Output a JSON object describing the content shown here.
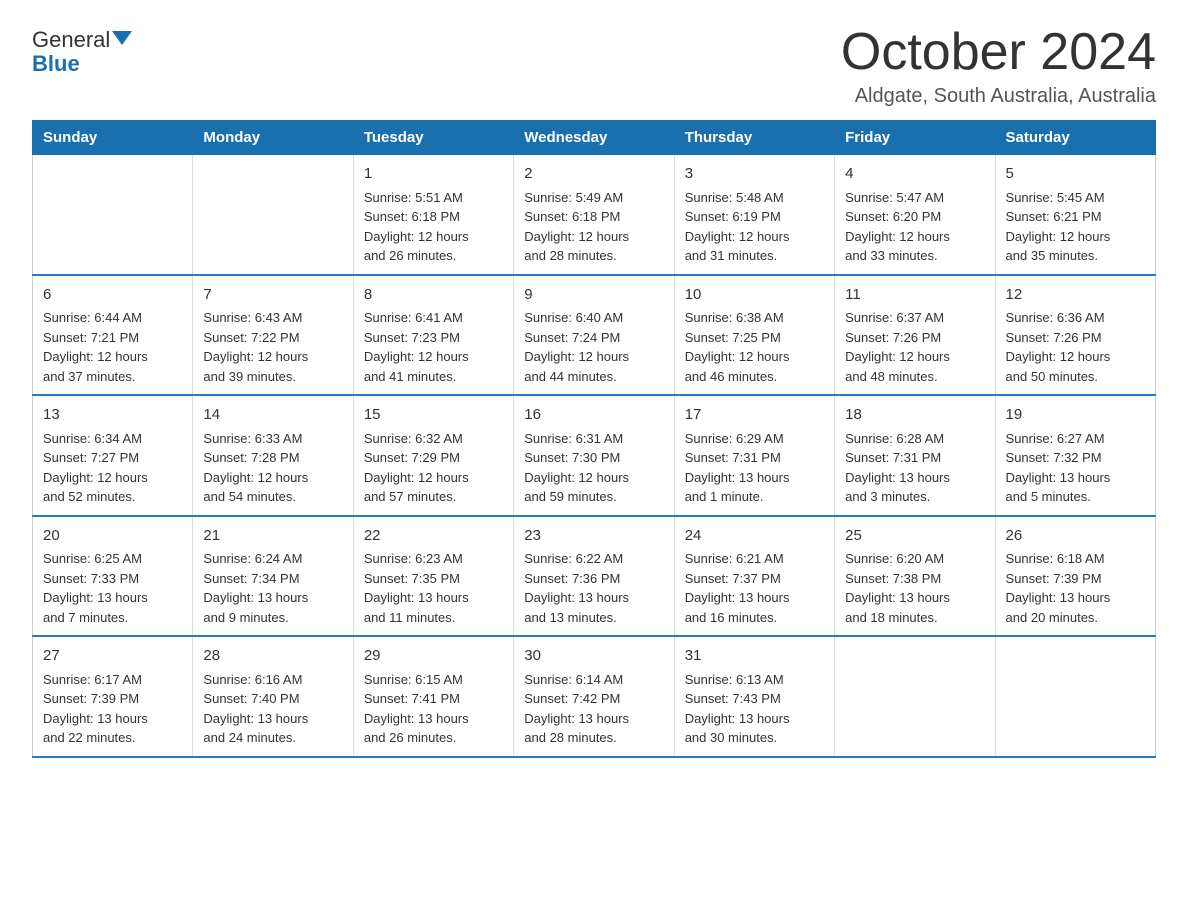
{
  "logo": {
    "general": "General",
    "blue": "Blue"
  },
  "header": {
    "month": "October 2024",
    "location": "Aldgate, South Australia, Australia"
  },
  "days": {
    "headers": [
      "Sunday",
      "Monday",
      "Tuesday",
      "Wednesday",
      "Thursday",
      "Friday",
      "Saturday"
    ]
  },
  "weeks": [
    [
      {
        "day": "",
        "detail": ""
      },
      {
        "day": "",
        "detail": ""
      },
      {
        "day": "1",
        "detail": "Sunrise: 5:51 AM\nSunset: 6:18 PM\nDaylight: 12 hours\nand 26 minutes."
      },
      {
        "day": "2",
        "detail": "Sunrise: 5:49 AM\nSunset: 6:18 PM\nDaylight: 12 hours\nand 28 minutes."
      },
      {
        "day": "3",
        "detail": "Sunrise: 5:48 AM\nSunset: 6:19 PM\nDaylight: 12 hours\nand 31 minutes."
      },
      {
        "day": "4",
        "detail": "Sunrise: 5:47 AM\nSunset: 6:20 PM\nDaylight: 12 hours\nand 33 minutes."
      },
      {
        "day": "5",
        "detail": "Sunrise: 5:45 AM\nSunset: 6:21 PM\nDaylight: 12 hours\nand 35 minutes."
      }
    ],
    [
      {
        "day": "6",
        "detail": "Sunrise: 6:44 AM\nSunset: 7:21 PM\nDaylight: 12 hours\nand 37 minutes."
      },
      {
        "day": "7",
        "detail": "Sunrise: 6:43 AM\nSunset: 7:22 PM\nDaylight: 12 hours\nand 39 minutes."
      },
      {
        "day": "8",
        "detail": "Sunrise: 6:41 AM\nSunset: 7:23 PM\nDaylight: 12 hours\nand 41 minutes."
      },
      {
        "day": "9",
        "detail": "Sunrise: 6:40 AM\nSunset: 7:24 PM\nDaylight: 12 hours\nand 44 minutes."
      },
      {
        "day": "10",
        "detail": "Sunrise: 6:38 AM\nSunset: 7:25 PM\nDaylight: 12 hours\nand 46 minutes."
      },
      {
        "day": "11",
        "detail": "Sunrise: 6:37 AM\nSunset: 7:26 PM\nDaylight: 12 hours\nand 48 minutes."
      },
      {
        "day": "12",
        "detail": "Sunrise: 6:36 AM\nSunset: 7:26 PM\nDaylight: 12 hours\nand 50 minutes."
      }
    ],
    [
      {
        "day": "13",
        "detail": "Sunrise: 6:34 AM\nSunset: 7:27 PM\nDaylight: 12 hours\nand 52 minutes."
      },
      {
        "day": "14",
        "detail": "Sunrise: 6:33 AM\nSunset: 7:28 PM\nDaylight: 12 hours\nand 54 minutes."
      },
      {
        "day": "15",
        "detail": "Sunrise: 6:32 AM\nSunset: 7:29 PM\nDaylight: 12 hours\nand 57 minutes."
      },
      {
        "day": "16",
        "detail": "Sunrise: 6:31 AM\nSunset: 7:30 PM\nDaylight: 12 hours\nand 59 minutes."
      },
      {
        "day": "17",
        "detail": "Sunrise: 6:29 AM\nSunset: 7:31 PM\nDaylight: 13 hours\nand 1 minute."
      },
      {
        "day": "18",
        "detail": "Sunrise: 6:28 AM\nSunset: 7:31 PM\nDaylight: 13 hours\nand 3 minutes."
      },
      {
        "day": "19",
        "detail": "Sunrise: 6:27 AM\nSunset: 7:32 PM\nDaylight: 13 hours\nand 5 minutes."
      }
    ],
    [
      {
        "day": "20",
        "detail": "Sunrise: 6:25 AM\nSunset: 7:33 PM\nDaylight: 13 hours\nand 7 minutes."
      },
      {
        "day": "21",
        "detail": "Sunrise: 6:24 AM\nSunset: 7:34 PM\nDaylight: 13 hours\nand 9 minutes."
      },
      {
        "day": "22",
        "detail": "Sunrise: 6:23 AM\nSunset: 7:35 PM\nDaylight: 13 hours\nand 11 minutes."
      },
      {
        "day": "23",
        "detail": "Sunrise: 6:22 AM\nSunset: 7:36 PM\nDaylight: 13 hours\nand 13 minutes."
      },
      {
        "day": "24",
        "detail": "Sunrise: 6:21 AM\nSunset: 7:37 PM\nDaylight: 13 hours\nand 16 minutes."
      },
      {
        "day": "25",
        "detail": "Sunrise: 6:20 AM\nSunset: 7:38 PM\nDaylight: 13 hours\nand 18 minutes."
      },
      {
        "day": "26",
        "detail": "Sunrise: 6:18 AM\nSunset: 7:39 PM\nDaylight: 13 hours\nand 20 minutes."
      }
    ],
    [
      {
        "day": "27",
        "detail": "Sunrise: 6:17 AM\nSunset: 7:39 PM\nDaylight: 13 hours\nand 22 minutes."
      },
      {
        "day": "28",
        "detail": "Sunrise: 6:16 AM\nSunset: 7:40 PM\nDaylight: 13 hours\nand 24 minutes."
      },
      {
        "day": "29",
        "detail": "Sunrise: 6:15 AM\nSunset: 7:41 PM\nDaylight: 13 hours\nand 26 minutes."
      },
      {
        "day": "30",
        "detail": "Sunrise: 6:14 AM\nSunset: 7:42 PM\nDaylight: 13 hours\nand 28 minutes."
      },
      {
        "day": "31",
        "detail": "Sunrise: 6:13 AM\nSunset: 7:43 PM\nDaylight: 13 hours\nand 30 minutes."
      },
      {
        "day": "",
        "detail": ""
      },
      {
        "day": "",
        "detail": ""
      }
    ]
  ]
}
